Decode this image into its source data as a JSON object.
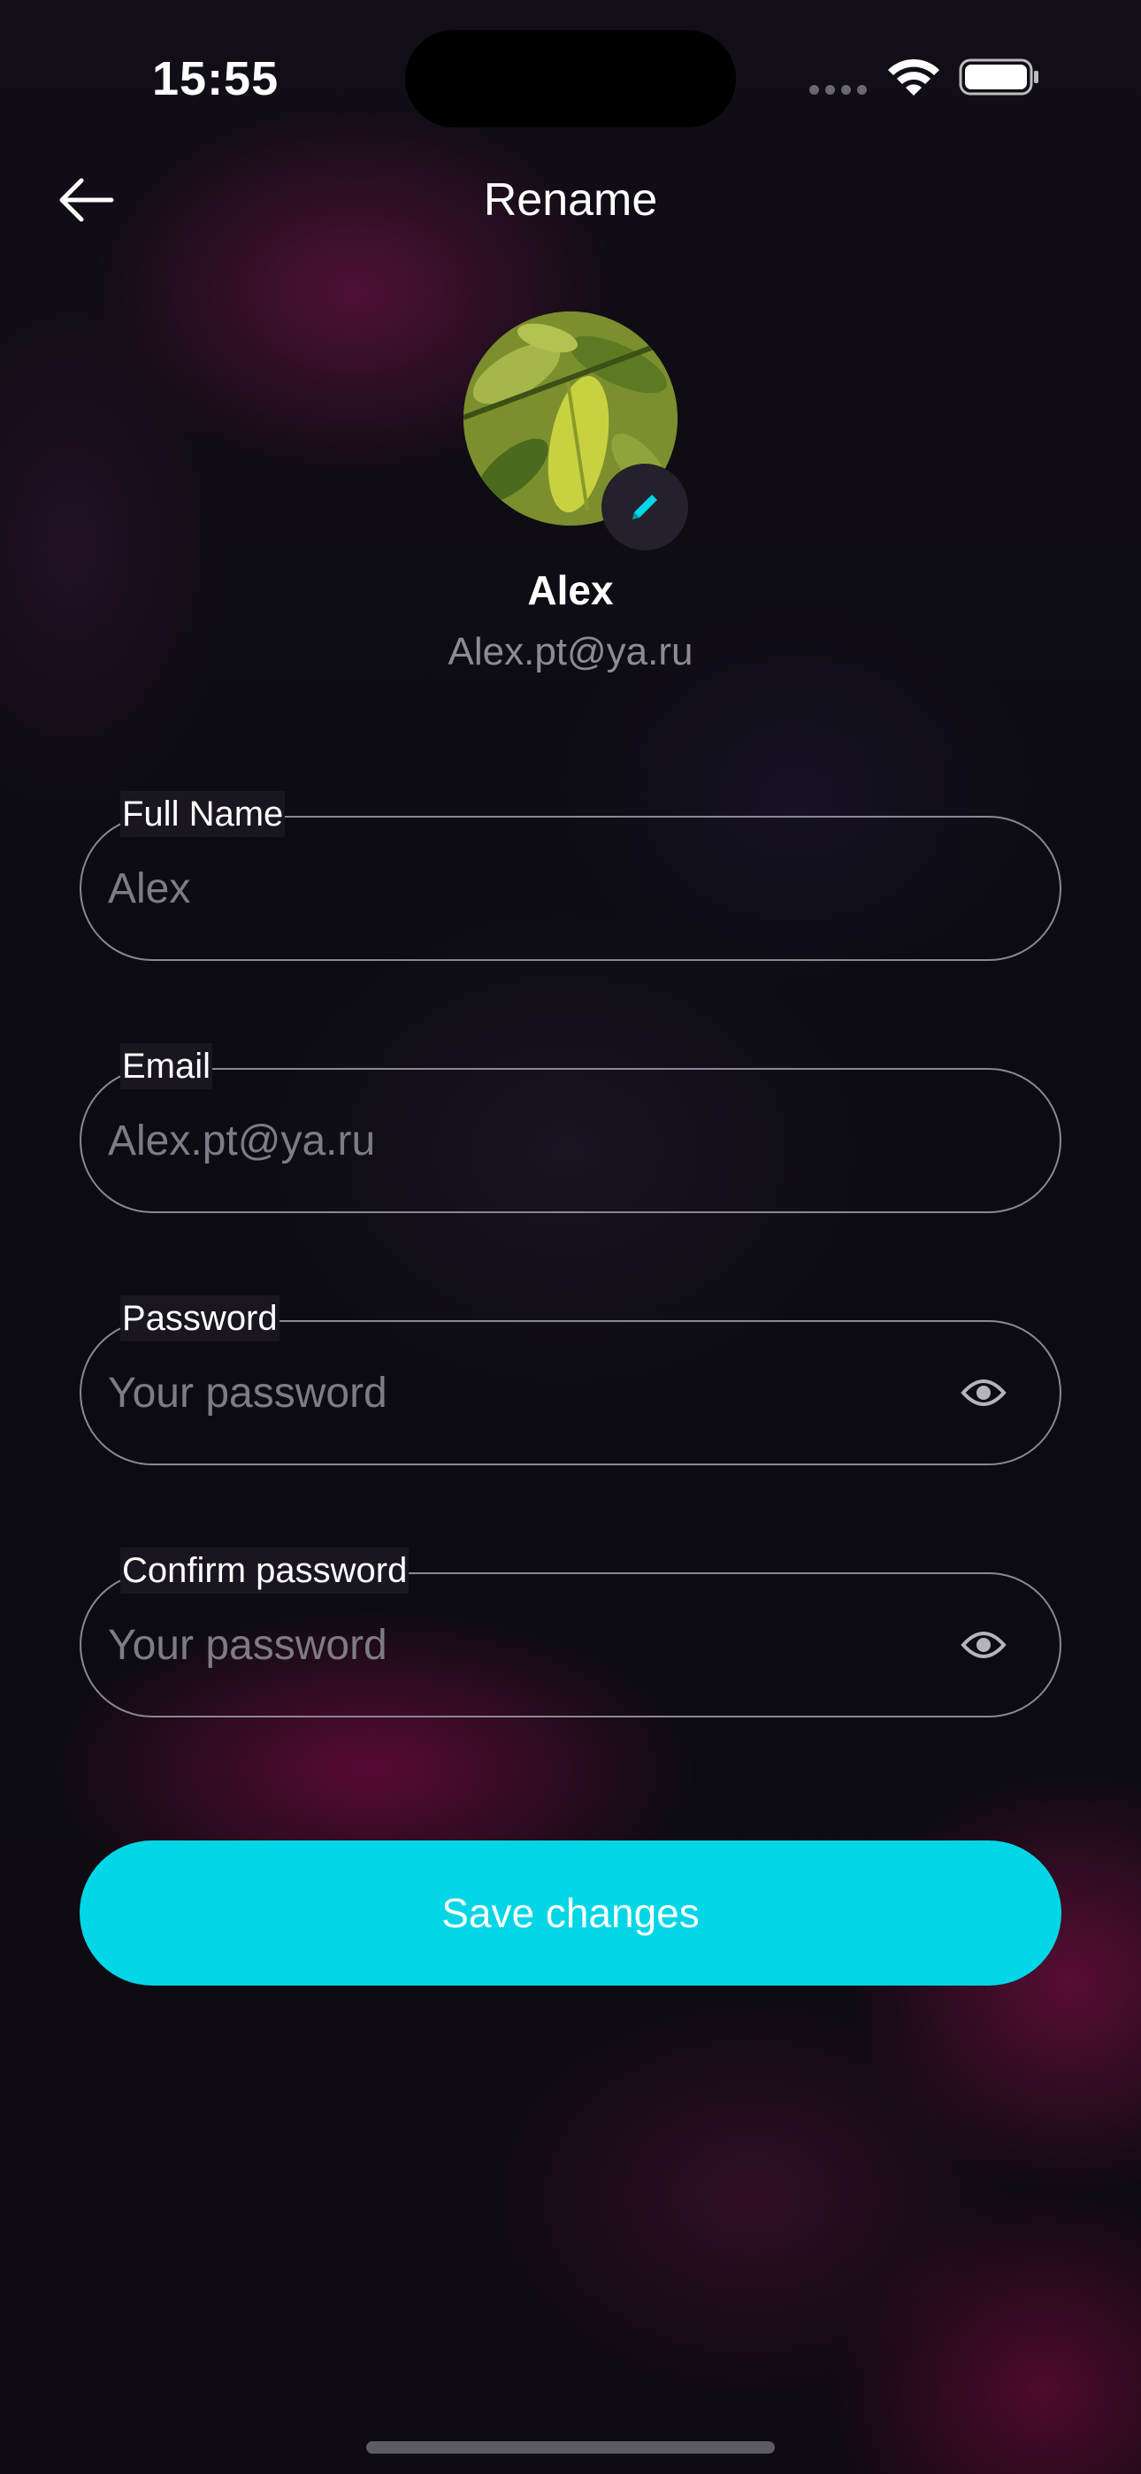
{
  "status_bar": {
    "time": "15:55"
  },
  "header": {
    "title": "Rename",
    "back_icon": "arrow-left-icon"
  },
  "profile": {
    "name": "Alex",
    "email": "Alex.pt@ya.ru",
    "edit_icon": "pencil-icon"
  },
  "form": {
    "full_name": {
      "label": "Full Name",
      "placeholder": "Alex"
    },
    "email": {
      "label": "Email",
      "placeholder": "Alex.pt@ya.ru"
    },
    "password": {
      "label": "Password",
      "placeholder": "Your password",
      "icon": "eye-icon"
    },
    "confirm_password": {
      "label": "Confirm password",
      "placeholder": "Your password",
      "icon": "eye-icon"
    }
  },
  "actions": {
    "save_label": "Save changes"
  },
  "colors": {
    "accent": "#03d6e6",
    "background": "#0b0a10",
    "muted_text": "#8c8a93",
    "field_border": "#8a8892"
  }
}
